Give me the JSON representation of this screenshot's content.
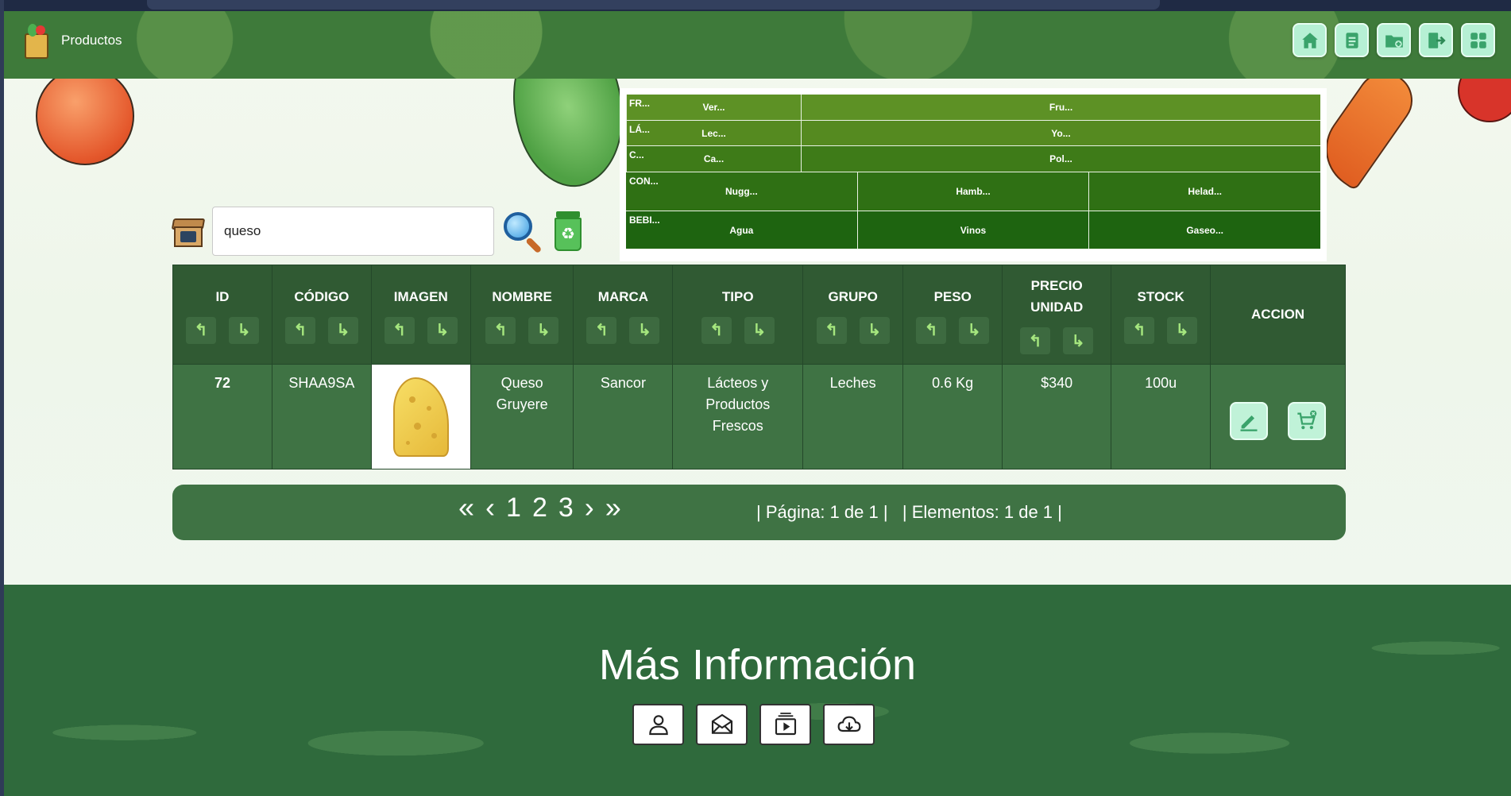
{
  "header": {
    "title": "Productos",
    "nav": [
      {
        "icon": "home-icon"
      },
      {
        "icon": "document-icon"
      },
      {
        "icon": "folder-add-icon"
      },
      {
        "icon": "logout-icon"
      },
      {
        "icon": "grid-icon"
      }
    ]
  },
  "categories": {
    "rows": [
      {
        "head": "FR...",
        "items": [
          "Ver...",
          "Fru..."
        ]
      },
      {
        "head": "LÁ...",
        "items": [
          "Lec...",
          "Yo..."
        ]
      },
      {
        "head": "C...",
        "items": [
          "Ca...",
          "Pol..."
        ]
      },
      {
        "head": "CON...",
        "items": [
          "Nugg...",
          "Hamb...",
          "Helad..."
        ]
      },
      {
        "head": "BEBI...",
        "items": [
          "Agua",
          "Vinos",
          "Gaseo..."
        ]
      }
    ]
  },
  "search": {
    "value": "queso"
  },
  "table": {
    "headers": [
      "ID",
      "CÓDIGO",
      "IMAGEN",
      "NOMBRE",
      "MARCA",
      "TIPO",
      "GRUPO",
      "PESO",
      "PRECIO UNIDAD",
      "STOCK",
      "ACCION"
    ],
    "rows": [
      {
        "id": "72",
        "codigo": "SHAA9SA",
        "imagen": "cheese-image",
        "nombre": "Queso Gruyere",
        "marca": "Sancor",
        "tipo": "Lácteos y Productos Frescos",
        "grupo": "Leches",
        "peso": "0.6 Kg",
        "precio": "$340",
        "stock": "100u"
      }
    ]
  },
  "pagination": {
    "pages": [
      "1",
      "2",
      "3"
    ],
    "status": "| Página: 1 de 1 |   | Elementos: 1 de 1 |"
  },
  "footer": {
    "title": "Más Información",
    "icons": [
      "user-icon",
      "mail-icon",
      "video-icon",
      "cloud-download-icon"
    ]
  },
  "colors": {
    "header_green": "#3e7a3a",
    "table_header": "#305a33",
    "table_row": "#3f7344",
    "footer_green": "#2f6a3c",
    "icon_button": "#b6f0d4"
  }
}
